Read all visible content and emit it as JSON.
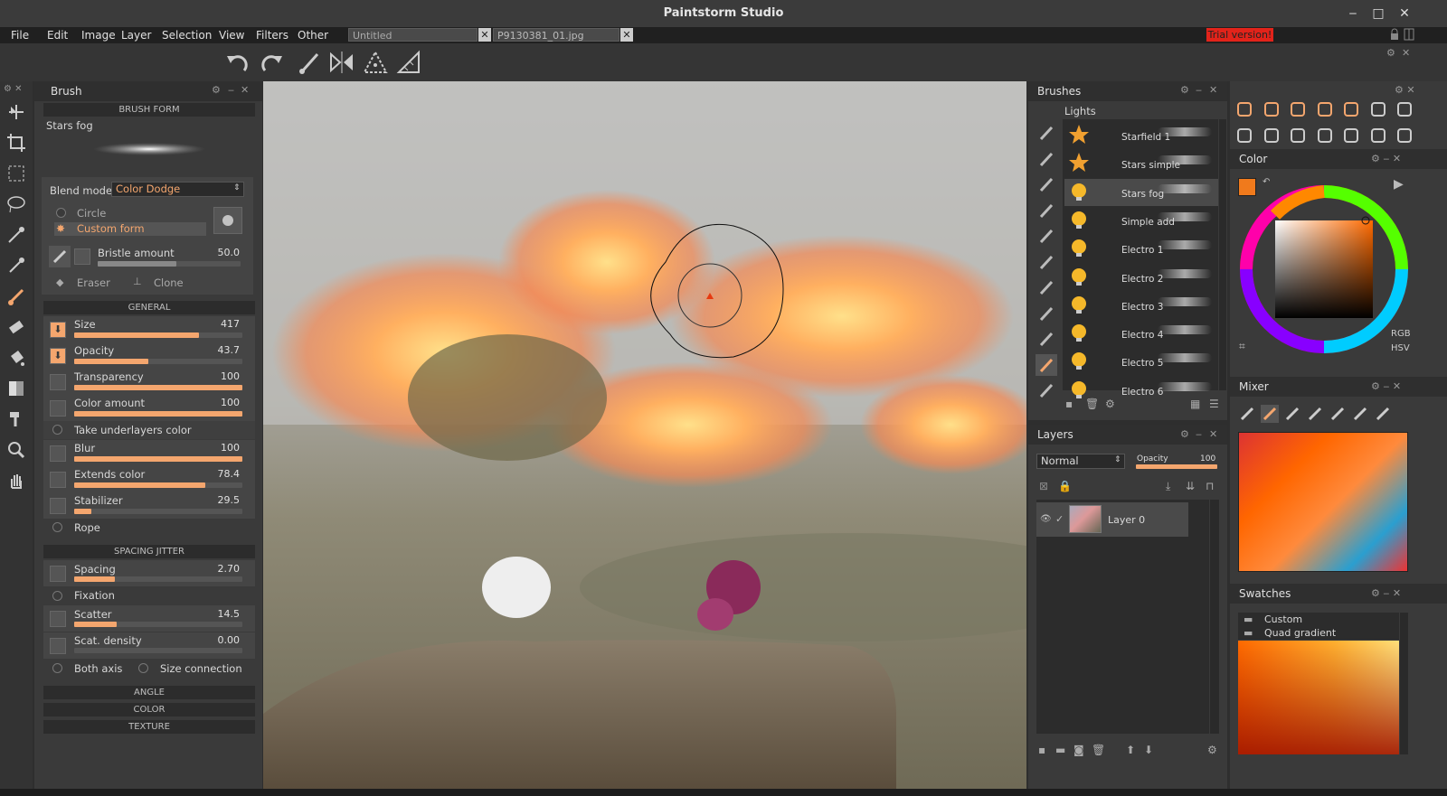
{
  "window": {
    "title": "Paintstorm Studio",
    "minimize": "‒",
    "maximize": "□",
    "close": "✕"
  },
  "menu": {
    "items": [
      "File",
      "Edit",
      "Image",
      "Layer",
      "Selection",
      "View",
      "Filters",
      "Other"
    ]
  },
  "doc_tabs": [
    {
      "label": "Untitled"
    },
    {
      "label": "P9130381_01.jpg"
    }
  ],
  "trial_badge": "Trial version!",
  "brush_panel": {
    "title": "Brush",
    "section_brush_form": "BRUSH FORM",
    "brush_name": "Stars fog",
    "blend_mode_label": "Blend mode:",
    "blend_mode_value": "Color Dodge",
    "shape_circle": "Circle",
    "shape_custom": "Custom form",
    "bristle_label": "Bristle amount",
    "bristle_value": "50.0",
    "bristle_fraction": 0.55,
    "eraser_label": "Eraser",
    "clone_label": "Clone",
    "section_general": "GENERAL",
    "sliders_general": [
      {
        "label": "Size",
        "value": "417",
        "fraction": 0.74
      },
      {
        "label": "Opacity",
        "value": "43.7",
        "fraction": 0.44
      },
      {
        "label": "Transparency",
        "value": "100",
        "fraction": 1.0
      },
      {
        "label": "Color amount",
        "value": "100",
        "fraction": 1.0
      }
    ],
    "take_underlayers": "Take underlayers color",
    "sliders_general2": [
      {
        "label": "Blur",
        "value": "100",
        "fraction": 1.0
      },
      {
        "label": "Extends color",
        "value": "78.4",
        "fraction": 0.78
      },
      {
        "label": "Stabilizer",
        "value": "29.5",
        "fraction": 0.1
      }
    ],
    "rope_label": "Rope",
    "section_spacing": "SPACING JITTER",
    "spacing": {
      "label": "Spacing",
      "value": "2.70",
      "fraction": 0.24
    },
    "fixation_label": "Fixation",
    "scatter": {
      "label": "Scatter",
      "value": "14.5",
      "fraction": 0.25
    },
    "scat_density": {
      "label": "Scat. density",
      "value": "0.00",
      "fraction": 0.0
    },
    "both_axis": "Both axis",
    "size_connection": "Size connection",
    "section_angle": "ANGLE",
    "section_color": "COLOR",
    "section_texture": "TEXTURE"
  },
  "brushes_panel": {
    "title": "Brushes",
    "group": "Lights",
    "items": [
      "Starfield 1",
      "Stars simple",
      "Stars fog",
      "Simple add",
      "Electro 1",
      "Electro 2",
      "Electro 3",
      "Electro 4",
      "Electro 5",
      "Electro 6"
    ]
  },
  "layers_panel": {
    "title": "Layers",
    "blend": "Normal",
    "opacity_label": "Opacity",
    "opacity_value": "100",
    "opacity_fraction": 1.0,
    "layer_name": "Layer 0"
  },
  "color_panel": {
    "title": "Color",
    "rgb": "RGB",
    "hsv": "HSV",
    "current_color": "#f07a1c"
  },
  "mixer_panel": {
    "title": "Mixer"
  },
  "swatches_panel": {
    "title": "Swatches",
    "items": [
      "Custom",
      "Quad gradient"
    ]
  },
  "colors": {
    "accent": "#f4a66e",
    "panel": "#3a3a3a",
    "trial": "#e2231a"
  }
}
